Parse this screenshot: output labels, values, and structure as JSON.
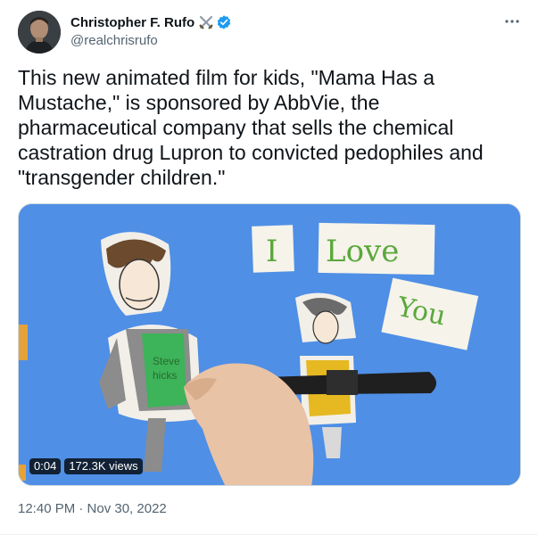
{
  "author": {
    "name": "Christopher F. Rufo",
    "handle": "@realchrisrufo",
    "badge_icons": [
      "crossed-swords-icon",
      "verified-badge-icon"
    ]
  },
  "tweet": {
    "text": "This new animated film for kids, \"Mama Has a Mustache,\" is sponsored by AbbVie, the pharmaceutical company that sells the chemical castration drug Lupron to convicted pedophiles and \"transgender children.\"",
    "timestamp": "12:40 PM · Nov 30, 2022"
  },
  "media": {
    "type": "video",
    "duration": "0:04",
    "views": "172.3K views",
    "scene_text": {
      "card_i": "I",
      "card_love": "Love",
      "card_you": "You",
      "shirt_text_1": "Steve",
      "shirt_text_2": "hicks"
    }
  },
  "colors": {
    "text_primary": "#0f1419",
    "text_secondary": "#536471",
    "verified_blue": "#1d9bf0",
    "media_background": "#4f8fe6"
  }
}
